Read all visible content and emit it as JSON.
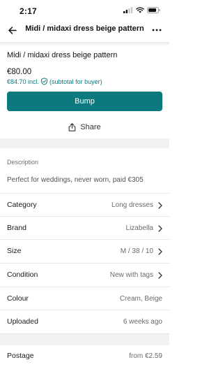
{
  "status_bar": {
    "time": "2:17"
  },
  "nav": {
    "title": "Midi / midaxi dress beige pattern"
  },
  "item": {
    "title": "Midi / midaxi dress beige pattern",
    "price": "€80.00",
    "buyer_price": "€84.70 incl.",
    "buyer_note": "(subtotal for buyer)"
  },
  "actions": {
    "bump_label": "Bump",
    "share_label": "Share"
  },
  "description": {
    "heading": "Description",
    "text": "Perfect for weddings, never worn, paid €305"
  },
  "details": [
    {
      "label": "Category",
      "value": "Long dresses"
    },
    {
      "label": "Brand",
      "value": "Lizabella"
    },
    {
      "label": "Size",
      "value": "M / 38 / 10"
    },
    {
      "label": "Condition",
      "value": "New with tags"
    },
    {
      "label": "Colour",
      "value": "Cream, Beige"
    },
    {
      "label": "Uploaded",
      "value": "6 weeks ago"
    }
  ],
  "postage": {
    "label": "Postage",
    "value": "from €2.59"
  },
  "colors": {
    "accent": "#0a7a7f",
    "section_gap": "#f2f2f2",
    "divider": "#e6e6e6"
  }
}
